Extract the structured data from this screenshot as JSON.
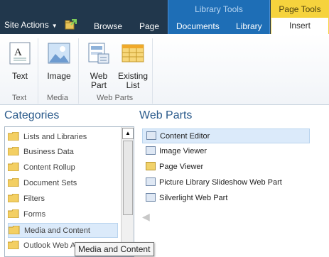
{
  "tabbar": {
    "site_actions": "Site Actions",
    "tabs": [
      "Browse",
      "Page",
      "Documents",
      "Library",
      "Insert"
    ],
    "library_tools": "Library Tools",
    "page_tools": "Page Tools"
  },
  "ribbon": {
    "buttons": {
      "text": "Text",
      "image": "Image",
      "web_part_line1": "Web",
      "web_part_line2": "Part",
      "existing_list_line1": "Existing",
      "existing_list_line2": "List"
    },
    "groups": {
      "text": "Text",
      "media": "Media",
      "web_parts": "Web Parts"
    }
  },
  "categories": {
    "title": "Categories",
    "items": [
      "Lists and Libraries",
      "Business Data",
      "Content Rollup",
      "Document Sets",
      "Filters",
      "Forms",
      "Media and Content",
      "Outlook Web A"
    ],
    "selected": "Media and Content"
  },
  "web_parts": {
    "title": "Web Parts",
    "items": [
      "Content Editor",
      "Image Viewer",
      "Page Viewer",
      "Picture Library Slideshow Web Part",
      "Silverlight Web Part"
    ],
    "selected": "Content Editor"
  },
  "tooltip": "Media and Content",
  "colors": {
    "tabbar": "#21374c",
    "library_tools": "#1e6eb6",
    "page_tools": "#f6d33d",
    "selection": "#dbeafa",
    "title_blue": "#2a5a8b"
  }
}
